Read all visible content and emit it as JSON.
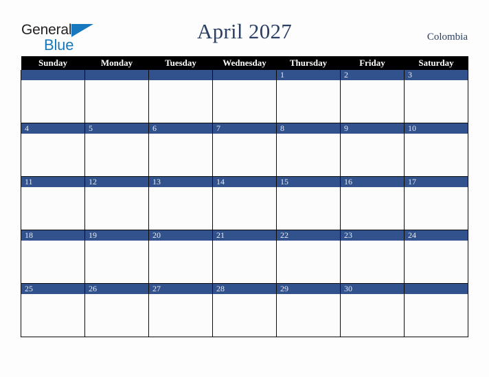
{
  "brand": {
    "logo_text_1": "General",
    "logo_text_2": "Blue",
    "logo_icon": "triangle-icon",
    "color_dark": "#231f20",
    "color_blue": "#1878be"
  },
  "header": {
    "title": "April 2027",
    "country": "Colombia",
    "title_color": "#2b3f63"
  },
  "calendar": {
    "weekday_headers": [
      "Sunday",
      "Monday",
      "Tuesday",
      "Wednesday",
      "Thursday",
      "Friday",
      "Saturday"
    ],
    "header_bg": "#000000",
    "header_fg": "#ffffff",
    "daybar_bg": "#31528d",
    "daybar_fg": "#e8ebf2",
    "cell_bg": "#fcfcfd",
    "grid_line": "#0a0a0a",
    "weeks": [
      {
        "days": [
          {
            "num": ""
          },
          {
            "num": ""
          },
          {
            "num": ""
          },
          {
            "num": ""
          },
          {
            "num": "1"
          },
          {
            "num": "2"
          },
          {
            "num": "3"
          }
        ]
      },
      {
        "days": [
          {
            "num": "4"
          },
          {
            "num": "5"
          },
          {
            "num": "6"
          },
          {
            "num": "7"
          },
          {
            "num": "8"
          },
          {
            "num": "9"
          },
          {
            "num": "10"
          }
        ]
      },
      {
        "days": [
          {
            "num": "11"
          },
          {
            "num": "12"
          },
          {
            "num": "13"
          },
          {
            "num": "14"
          },
          {
            "num": "15"
          },
          {
            "num": "16"
          },
          {
            "num": "17"
          }
        ]
      },
      {
        "days": [
          {
            "num": "18"
          },
          {
            "num": "19"
          },
          {
            "num": "20"
          },
          {
            "num": "21"
          },
          {
            "num": "22"
          },
          {
            "num": "23"
          },
          {
            "num": "24"
          }
        ]
      },
      {
        "days": [
          {
            "num": "25"
          },
          {
            "num": "26"
          },
          {
            "num": "27"
          },
          {
            "num": "28"
          },
          {
            "num": "29"
          },
          {
            "num": "30"
          },
          {
            "num": ""
          }
        ]
      }
    ]
  }
}
